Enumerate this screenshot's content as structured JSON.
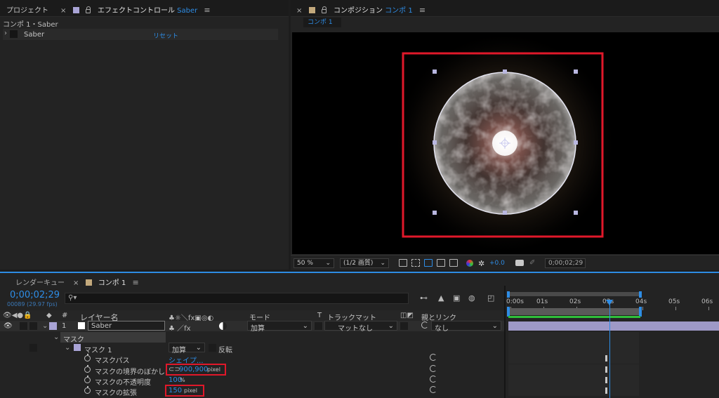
{
  "left_panel": {
    "tab_project": "プロジェクト",
    "tab_effect_prefix": "エフェクトコントロール",
    "tab_effect_layer": "Saber",
    "breadcrumb": "コンポ 1・Saber",
    "effect_name": "Saber",
    "reset_label": "リセット"
  },
  "viewer": {
    "tab_prefix": "コンポジション",
    "tab_comp": "コンポ 1",
    "comp_tab": "コンポ 1",
    "zoom": "50 %",
    "quality": "(1/2 画質)",
    "exposure": "+0.0",
    "timecode": "0;00;02;29"
  },
  "timeline": {
    "tab_render_queue": "レンダーキュー",
    "tab_comp": "コンポ 1",
    "timecode": "0;00;02;29",
    "frame_info": "00089 (29.97 fps)",
    "search_glyph": "⚲▾",
    "col_num": "#",
    "col_layer_name": "レイヤー名",
    "col_mode": "モード",
    "col_t": "T",
    "col_track_matte": "トラックマット",
    "col_parent": "親とリンク",
    "layer": {
      "number": "1",
      "name": "Saber",
      "mode": "加算",
      "matte": "マットなし",
      "parent": "なし"
    },
    "mask_group": "マスク",
    "mask1": {
      "name": "マスク 1",
      "mode": "加算",
      "invert": "反転"
    },
    "props": [
      {
        "name": "マスクパス",
        "value": "シェイプ...",
        "unit": ""
      },
      {
        "name": "マスクの境界のぼかし",
        "value": "900,900",
        "unit": "pixel"
      },
      {
        "name": "マスクの不透明度",
        "value": "100",
        "unit": "%"
      },
      {
        "name": "マスクの拡張",
        "value": "150",
        "unit": "pixel"
      }
    ],
    "ruler": [
      "0:00s",
      "01s",
      "02s",
      "03s",
      "04s",
      "05s",
      "06s"
    ],
    "playhead_time_seconds": 3
  },
  "colors": {
    "accent_blue": "#2e8de6",
    "highlight_red": "#e0182a",
    "layer_label": "#a9a4d6",
    "panel_bg": "#232323"
  }
}
